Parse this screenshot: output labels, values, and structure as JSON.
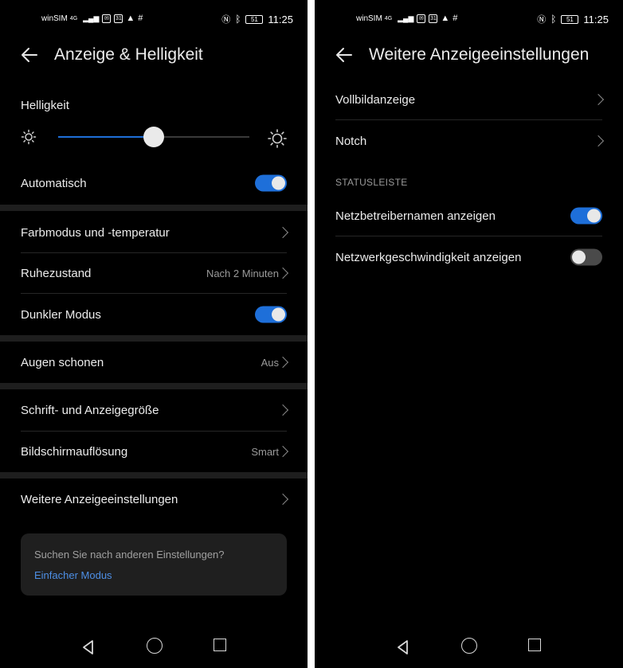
{
  "status_bar": {
    "carrier": "winSIM",
    "network": "4G",
    "battery": "51",
    "time": "11:25",
    "icons": [
      "mail-icon",
      "calendar-icon",
      "drive-icon",
      "slack-icon",
      "nfc-icon",
      "bluetooth-icon"
    ]
  },
  "left": {
    "title": "Anzeige & Helligkeit",
    "brightness": {
      "label": "Helligkeit",
      "level": 0.5
    },
    "rows": {
      "automatisch": {
        "label": "Automatisch",
        "on": true
      },
      "farbmodus": {
        "label": "Farbmodus und -temperatur"
      },
      "ruhezustand": {
        "label": "Ruhezustand",
        "value": "Nach 2 Minuten"
      },
      "dunkler": {
        "label": "Dunkler Modus",
        "on": true
      },
      "augen": {
        "label": "Augen schonen",
        "value": "Aus"
      },
      "schrift": {
        "label": "Schrift- und Anzeigegröße"
      },
      "aufloesung": {
        "label": "Bildschirmauflösung",
        "value": "Smart"
      },
      "weitere": {
        "label": "Weitere Anzeigeeinstellungen"
      }
    },
    "card": {
      "question": "Suchen Sie nach anderen Einstellungen?",
      "link": "Einfacher Modus"
    }
  },
  "right": {
    "title": "Weitere Anzeigeeinstellungen",
    "rows": {
      "vollbild": {
        "label": "Vollbildanzeige"
      },
      "notch": {
        "label": "Notch"
      },
      "netzbetreiber": {
        "label": "Netzbetreibernamen anzeigen",
        "on": true
      },
      "netzwerk": {
        "label": "Netzwerkgeschwindigkeit anzeigen",
        "on": false
      }
    },
    "section": "STATUSLEISTE"
  },
  "colors": {
    "accent": "#1e6fd9",
    "link": "#4d8fe6",
    "background": "#000000"
  }
}
